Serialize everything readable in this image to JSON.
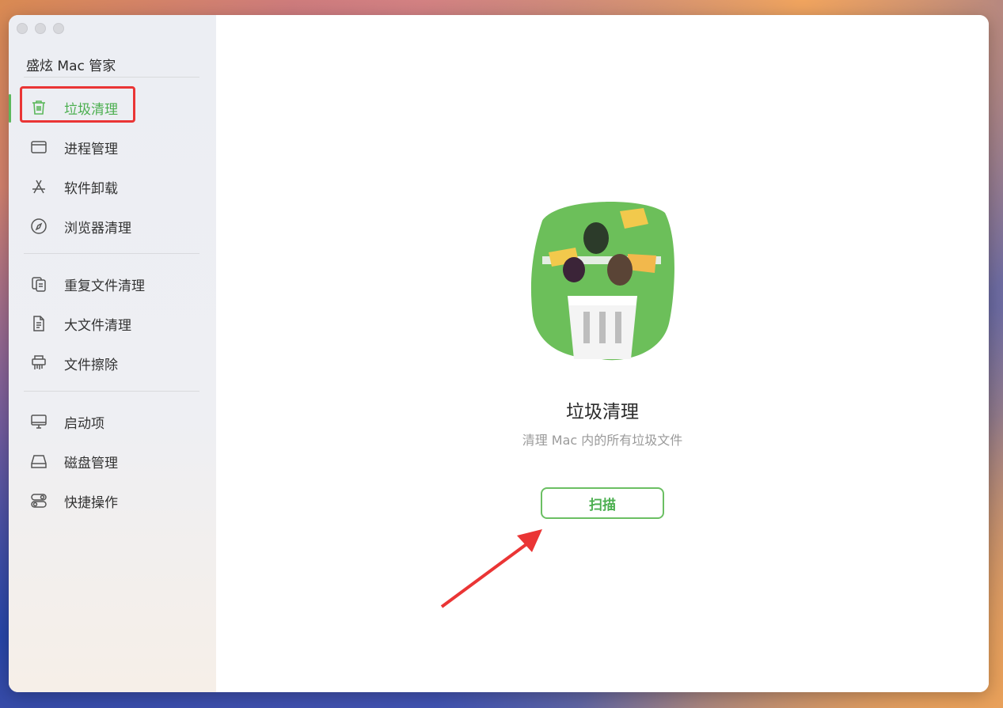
{
  "app": {
    "title": "盛炫 Mac 管家"
  },
  "sidebar": {
    "groups": [
      [
        {
          "label": "垃圾清理",
          "icon": "trash-icon",
          "active": true
        },
        {
          "label": "进程管理",
          "icon": "window-icon"
        },
        {
          "label": "软件卸载",
          "icon": "app-store-icon"
        },
        {
          "label": "浏览器清理",
          "icon": "compass-icon"
        }
      ],
      [
        {
          "label": "重复文件清理",
          "icon": "duplicate-files-icon"
        },
        {
          "label": "大文件清理",
          "icon": "document-icon"
        },
        {
          "label": "文件擦除",
          "icon": "shredder-icon"
        }
      ],
      [
        {
          "label": "启动项",
          "icon": "monitor-icon"
        },
        {
          "label": "磁盘管理",
          "icon": "disk-icon"
        },
        {
          "label": "快捷操作",
          "icon": "toggles-icon"
        }
      ]
    ]
  },
  "main": {
    "title": "垃圾清理",
    "subtitle": "清理 Mac 内的所有垃圾文件",
    "scan_label": "扫描"
  },
  "colors": {
    "accent": "#4caf50",
    "annotation": "#ea3535"
  }
}
